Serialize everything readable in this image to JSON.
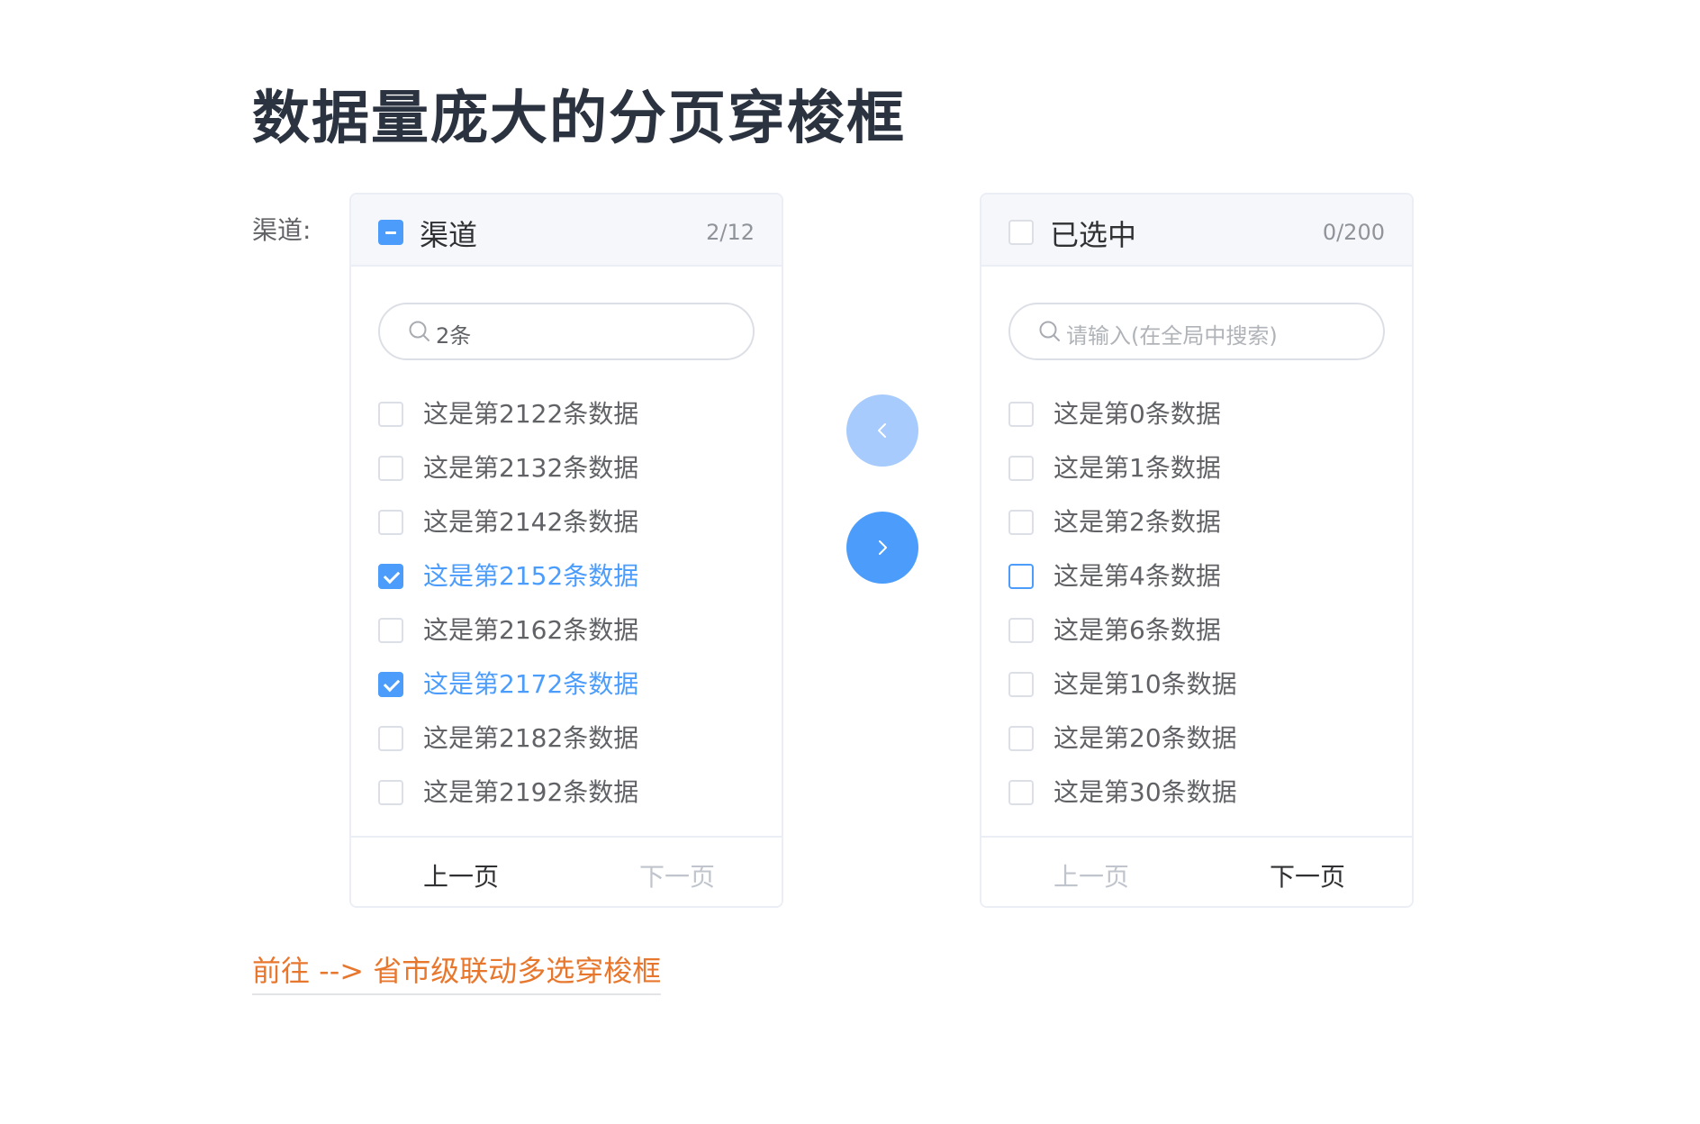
{
  "page": {
    "title": "数据量庞大的分页穿梭框"
  },
  "form": {
    "label": "渠道:"
  },
  "left_panel": {
    "title": "渠道",
    "count": "2/12",
    "header_check_state": "indeterminate",
    "search": {
      "value": "2条",
      "placeholder": ""
    },
    "items": [
      {
        "label": "这是第2122条数据",
        "checked": false
      },
      {
        "label": "这是第2132条数据",
        "checked": false
      },
      {
        "label": "这是第2142条数据",
        "checked": false
      },
      {
        "label": "这是第2152条数据",
        "checked": true
      },
      {
        "label": "这是第2162条数据",
        "checked": false
      },
      {
        "label": "这是第2172条数据",
        "checked": true
      },
      {
        "label": "这是第2182条数据",
        "checked": false
      },
      {
        "label": "这是第2192条数据",
        "checked": false
      }
    ],
    "pager": {
      "prev_label": "上一页",
      "next_label": "下一页",
      "prev_disabled": false,
      "next_disabled": true
    }
  },
  "right_panel": {
    "title": "已选中",
    "count": "0/200",
    "header_check_state": "unchecked",
    "search": {
      "value": "",
      "placeholder": "请输入(在全局中搜索)"
    },
    "items": [
      {
        "label": "这是第0条数据",
        "checked": false
      },
      {
        "label": "这是第1条数据",
        "checked": false
      },
      {
        "label": "这是第2条数据",
        "checked": false
      },
      {
        "label": "这是第4条数据",
        "checked": false,
        "focused": true
      },
      {
        "label": "这是第6条数据",
        "checked": false
      },
      {
        "label": "这是第10条数据",
        "checked": false
      },
      {
        "label": "这是第20条数据",
        "checked": false
      },
      {
        "label": "这是第30条数据",
        "checked": false
      }
    ],
    "pager": {
      "prev_label": "上一页",
      "next_label": "下一页",
      "prev_disabled": true,
      "next_disabled": false
    }
  },
  "transfer": {
    "to_left_icon": "chevron-left-icon",
    "to_right_icon": "chevron-right-icon",
    "to_left_disabled": true,
    "to_right_disabled": false
  },
  "link": {
    "text": "前往 --> 省市级联动多选穿梭框"
  },
  "colors": {
    "primary": "#4c9dfb",
    "primary_light": "#a6cbfc",
    "link": "#e8772e",
    "title": "#2b3340",
    "border": "#ebeef5"
  }
}
